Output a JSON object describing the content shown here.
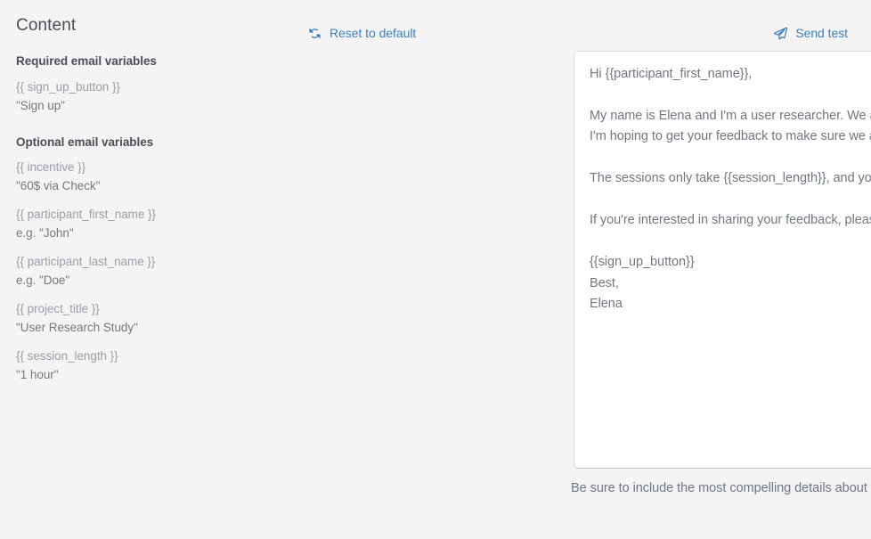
{
  "sidebar": {
    "title": "Content",
    "required": {
      "heading": "Required email variables",
      "items": [
        {
          "token": "{{ sign_up_button }}",
          "example": "\"Sign up\""
        }
      ]
    },
    "optional": {
      "heading": "Optional email variables",
      "items": [
        {
          "token": "{{ incentive }}",
          "example": "\"60$ via Check\""
        },
        {
          "token": "{{ participant_first_name }}",
          "example": "e.g. \"John\""
        },
        {
          "token": "{{ participant_last_name }}",
          "example": "e.g. \"Doe\""
        },
        {
          "token": "{{ project_title }}",
          "example": "\"User Research Study\""
        },
        {
          "token": "{{ session_length }}",
          "example": "\"1 hour\""
        }
      ]
    }
  },
  "toolbar": {
    "reset_label": "Reset to default",
    "reset_icon": "refresh-icon",
    "send_label": "Send test",
    "send_icon": "paper-plane-icon",
    "link_color": "#3d7eb8"
  },
  "editor": {
    "body": "Hi {{participant_first_name}},\n\nMy name is Elena and I'm a user researcher. We are working on some new concepts and I'm hoping to get your feedback to make sure we are meeting our users' needs.\n\nThe sessions only take {{session_length}}, and you'll receive {{incentive}} as a thank-you.\n\nIf you're interested in sharing your feedback, please click the button below to sign up!\n\n{{sign_up_button}}\nBest,\nElena",
    "status_icon": "check-circle-icon",
    "status_color": "#4aa3f0"
  },
  "helper": {
    "text": "Be sure to include the most compelling details about the project to  improve your response rate."
  }
}
